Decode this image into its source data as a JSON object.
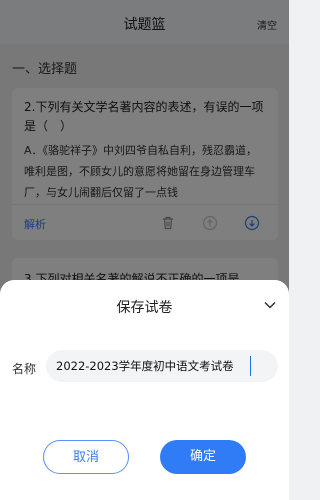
{
  "header": {
    "title": "试题篮",
    "clear_label": "清空"
  },
  "section": {
    "title": "一、选择题"
  },
  "questions": [
    {
      "stem": "2.下列有关文学名著内容的表述，有误的一项是（　）",
      "option_a": "A．《骆驼祥子》中刘四爷自私自利，残忍霸道，唯利是图，不顾女儿的意愿将她留在身边管理车厂，与女儿闹翻后仅留了一点钱",
      "analysis_label": "解析"
    },
    {
      "stem": "3.下列对相关名著的解说不正确的一项是"
    }
  ],
  "dialog": {
    "title": "保存试卷",
    "name_label": "名称",
    "name_value": "2022-2023学年度初中语文考试卷",
    "cancel_label": "取消",
    "confirm_label": "确定"
  },
  "colors": {
    "accent": "#2f7cf6",
    "overlay": "rgba(0,0,0,0.5)"
  }
}
